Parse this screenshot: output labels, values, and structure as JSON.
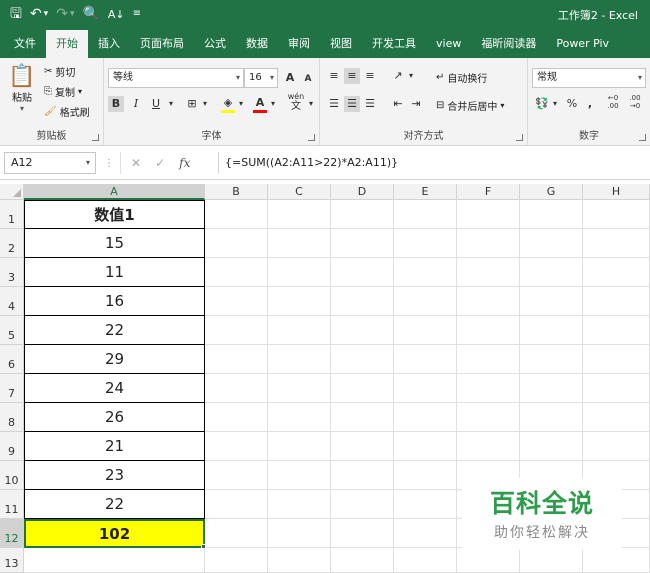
{
  "window": {
    "title": "工作簿2  -  Excel"
  },
  "qat": {
    "save_icon": "save-icon",
    "undo_icon": "undo-icon",
    "redo_icon": "redo-icon",
    "preview_icon": "print-preview-icon",
    "sort_icon": "sort-icon",
    "customize_icon": "customize-qat-icon"
  },
  "ribbon_tabs": [
    "文件",
    "开始",
    "插入",
    "页面布局",
    "公式",
    "数据",
    "审阅",
    "视图",
    "开发工具",
    "view",
    "福昕阅读器",
    "Power Piv"
  ],
  "active_tab": "开始",
  "clipboard": {
    "paste": "粘贴",
    "cut": "剪切",
    "copy": "复制",
    "format_painter": "格式刷",
    "label": "剪贴板"
  },
  "font": {
    "name": "等线",
    "size": "16",
    "grow": "A",
    "shrink": "A",
    "bold": "B",
    "italic": "I",
    "underline": "U",
    "phonetic": "wén",
    "phonetic_char": "文",
    "label": "字体",
    "fill_color": "#ffff00",
    "font_color": "#ff0000"
  },
  "alignment": {
    "wrap": "自动换行",
    "merge": "合并后居中",
    "label": "对齐方式"
  },
  "number": {
    "format": "常规",
    "percent": "%",
    "comma": ",",
    "inc_decimal": "←0 .00",
    "dec_decimal": ".00 →0",
    "label": "数字"
  },
  "formula_bar": {
    "name_box": "A12",
    "cancel": "✕",
    "enter": "✓",
    "fx": "fx",
    "formula": "{=SUM((A2:A11>22)*A2:A11)}"
  },
  "columns": [
    "A",
    "B",
    "C",
    "D",
    "E",
    "F",
    "G",
    "H"
  ],
  "rows": [
    "1",
    "2",
    "3",
    "4",
    "5",
    "6",
    "7",
    "8",
    "9",
    "10",
    "11",
    "12",
    "13"
  ],
  "table": {
    "header": "数值1",
    "values": [
      "15",
      "11",
      "16",
      "22",
      "29",
      "24",
      "26",
      "21",
      "23",
      "22"
    ],
    "total": "102"
  },
  "watermark": {
    "title": "百科全说",
    "subtitle": "助你轻松解决"
  },
  "colors": {
    "excel_green": "#217346",
    "highlight": "#ffff00",
    "watermark_green": "#2e9d4b"
  }
}
